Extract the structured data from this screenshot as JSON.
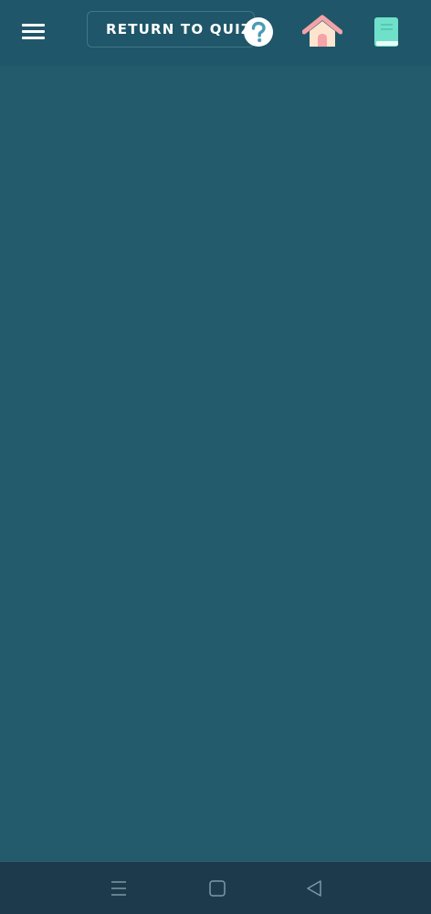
{
  "header": {
    "return_label": "RETURN TO QUIZ"
  },
  "icons": {
    "menu": "hamburger-menu-icon",
    "help": "question-mark-icon",
    "home": "house-icon",
    "book": "book-icon"
  },
  "colors": {
    "header_bg": "#1f5669",
    "content_bg": "#235b6d",
    "navbar_bg": "#1d3a4d",
    "help_accent": "#4a9bb3",
    "home_roof": "#f4a3a8",
    "home_wall": "#fde4cf",
    "book_cover": "#6fe0c9"
  },
  "system_nav": {
    "buttons": [
      "recent-apps",
      "home",
      "back"
    ]
  }
}
